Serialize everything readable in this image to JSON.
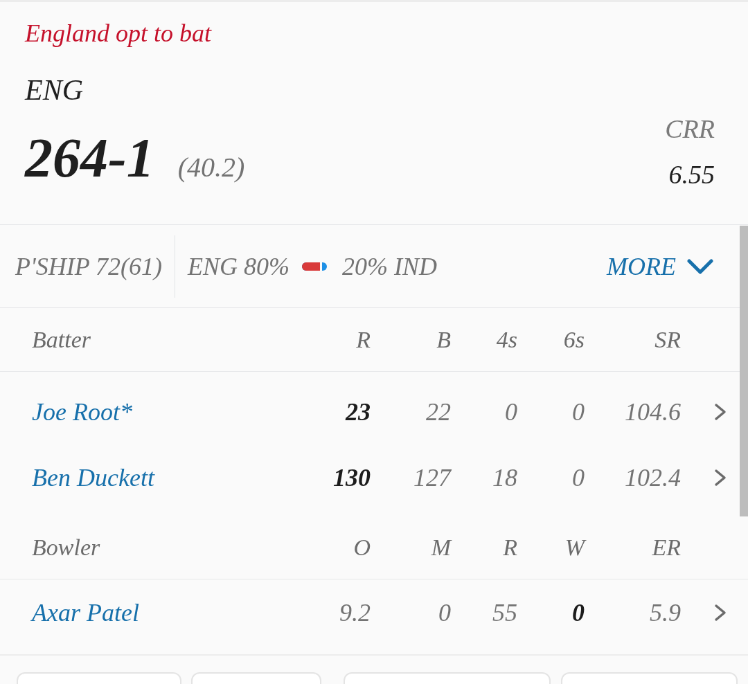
{
  "toss": {
    "text": "England opt to bat"
  },
  "score": {
    "team": "ENG",
    "runs": "264-1",
    "overs": "(40.2)",
    "run_rate": {
      "label": "CRR",
      "value": "6.55"
    }
  },
  "info_bar": {
    "partnership": "P'SHIP 72(61)",
    "win_probability": {
      "teams": [
        {
          "label": "ENG 80%",
          "color": "#d93a3a"
        },
        {
          "label": "20% IND",
          "color": "#1e90e6"
        }
      ],
      "level": 0.8
    },
    "more": {
      "label": "MORE",
      "expanded": false
    }
  },
  "batting": {
    "columns": [
      "Batter",
      "R",
      "B",
      "4s",
      "6s",
      "SR"
    ],
    "rows": [
      {
        "cells": [
          {
            "text": "Joe Root*",
            "bold": false
          },
          {
            "text": "23",
            "bold": true
          },
          {
            "text": "22",
            "bold": false
          },
          {
            "text": "0",
            "bold": false
          },
          {
            "text": "0",
            "bold": false
          },
          {
            "text": "104.6",
            "bold": false
          }
        ]
      },
      {
        "cells": [
          {
            "text": "Ben Duckett",
            "bold": false
          },
          {
            "text": "130",
            "bold": true
          },
          {
            "text": "127",
            "bold": false
          },
          {
            "text": "18",
            "bold": false
          },
          {
            "text": "0",
            "bold": false
          },
          {
            "text": "102.4",
            "bold": false
          }
        ]
      }
    ]
  },
  "bowling": {
    "columns": [
      "Bowler",
      "O",
      "M",
      "R",
      "W",
      "ER"
    ],
    "rows": [
      {
        "cells": [
          {
            "text": "Axar Patel",
            "bold": false
          },
          {
            "text": "9.2",
            "bold": false
          },
          {
            "text": "0",
            "bold": false
          },
          {
            "text": "55",
            "bold": false
          },
          {
            "text": "0",
            "bold": true
          },
          {
            "text": "5.9",
            "bold": false
          }
        ]
      }
    ]
  }
}
